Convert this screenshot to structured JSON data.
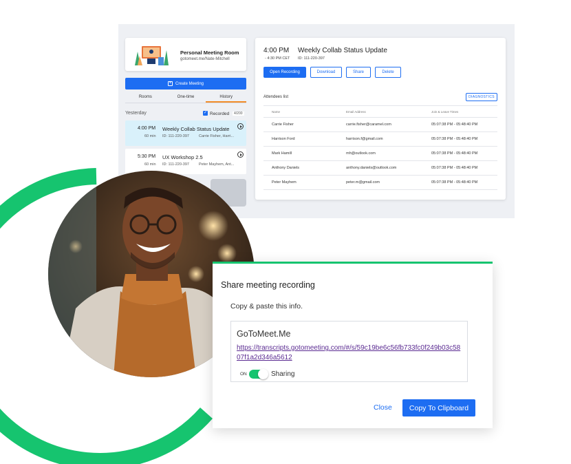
{
  "room": {
    "title": "Personal Meeting Room",
    "link": "gotomeet.me/Nate-Mitchell"
  },
  "create_meeting_label": "Create Meeting",
  "tabs": [
    {
      "label": "Rooms"
    },
    {
      "label": "One-time"
    },
    {
      "label": "History"
    }
  ],
  "history": {
    "section_label": "Yesterday",
    "recorded_label": "Recorded",
    "recorded_count": "4/200",
    "items": [
      {
        "time": "4:00 PM",
        "duration": "60 min",
        "title": "Weekly Collab Status Update",
        "id": "ID: 111-220-397",
        "people": "Carrie Fisher, Harri..."
      },
      {
        "time": "5:30 PM",
        "duration": "60 min",
        "title": "UX Workshop 2.5",
        "id": "ID: 111-220-397",
        "people": "Peter Mayhem, Ant..."
      }
    ]
  },
  "detail": {
    "time": "4:00 PM",
    "time_sub": "- 4:30 PM CET",
    "title": "Weekly Collab Status Update",
    "id": "ID: 111-220-397",
    "buttons": {
      "open_recording": "Open Recording",
      "download": "Download",
      "share": "Share",
      "delete": "Delete"
    },
    "attendees_label": "Attendees list",
    "diagnostics_label": "DIAGNOSTICS",
    "columns": [
      "Name",
      "Email Address",
      "Join & Leave Times"
    ],
    "rows": [
      [
        "Carrie Fisher",
        "carrie.fisher@caramel.com",
        "05:07:38 PM - 05:48:40 PM"
      ],
      [
        "Harrison Ford",
        "harrison.f@gmail.com",
        "05:07:38 PM - 05:48:40 PM"
      ],
      [
        "Mark Hamill",
        "mh@outlook.com",
        "05:07:38 PM - 05:48:40 PM"
      ],
      [
        "Anthony Daniels",
        "anthony.daniels@outlook.com",
        "05:07:38 PM - 05:48:40 PM"
      ],
      [
        "Peter Mayhem",
        "peter.m@gmail.com",
        "05:07:38 PM - 05:48:40 PM"
      ]
    ]
  },
  "dialog": {
    "title": "Share meeting recording",
    "subtitle": "Copy & paste this info.",
    "brand": "GoToMeet.Me",
    "url": "https://transcripts.gotomeeting.com/#/s/59c19be6c56fb733fc0f249b03c5807f1a2d346a5612",
    "toggle_state": "ON",
    "toggle_label": "Sharing",
    "close_label": "Close",
    "copy_label": "Copy To Clipboard"
  },
  "colors": {
    "accent_blue": "#1d6df2",
    "brand_green": "#16c46f",
    "tab_orange": "#f28c28",
    "selected_row": "#d9f1fb"
  }
}
